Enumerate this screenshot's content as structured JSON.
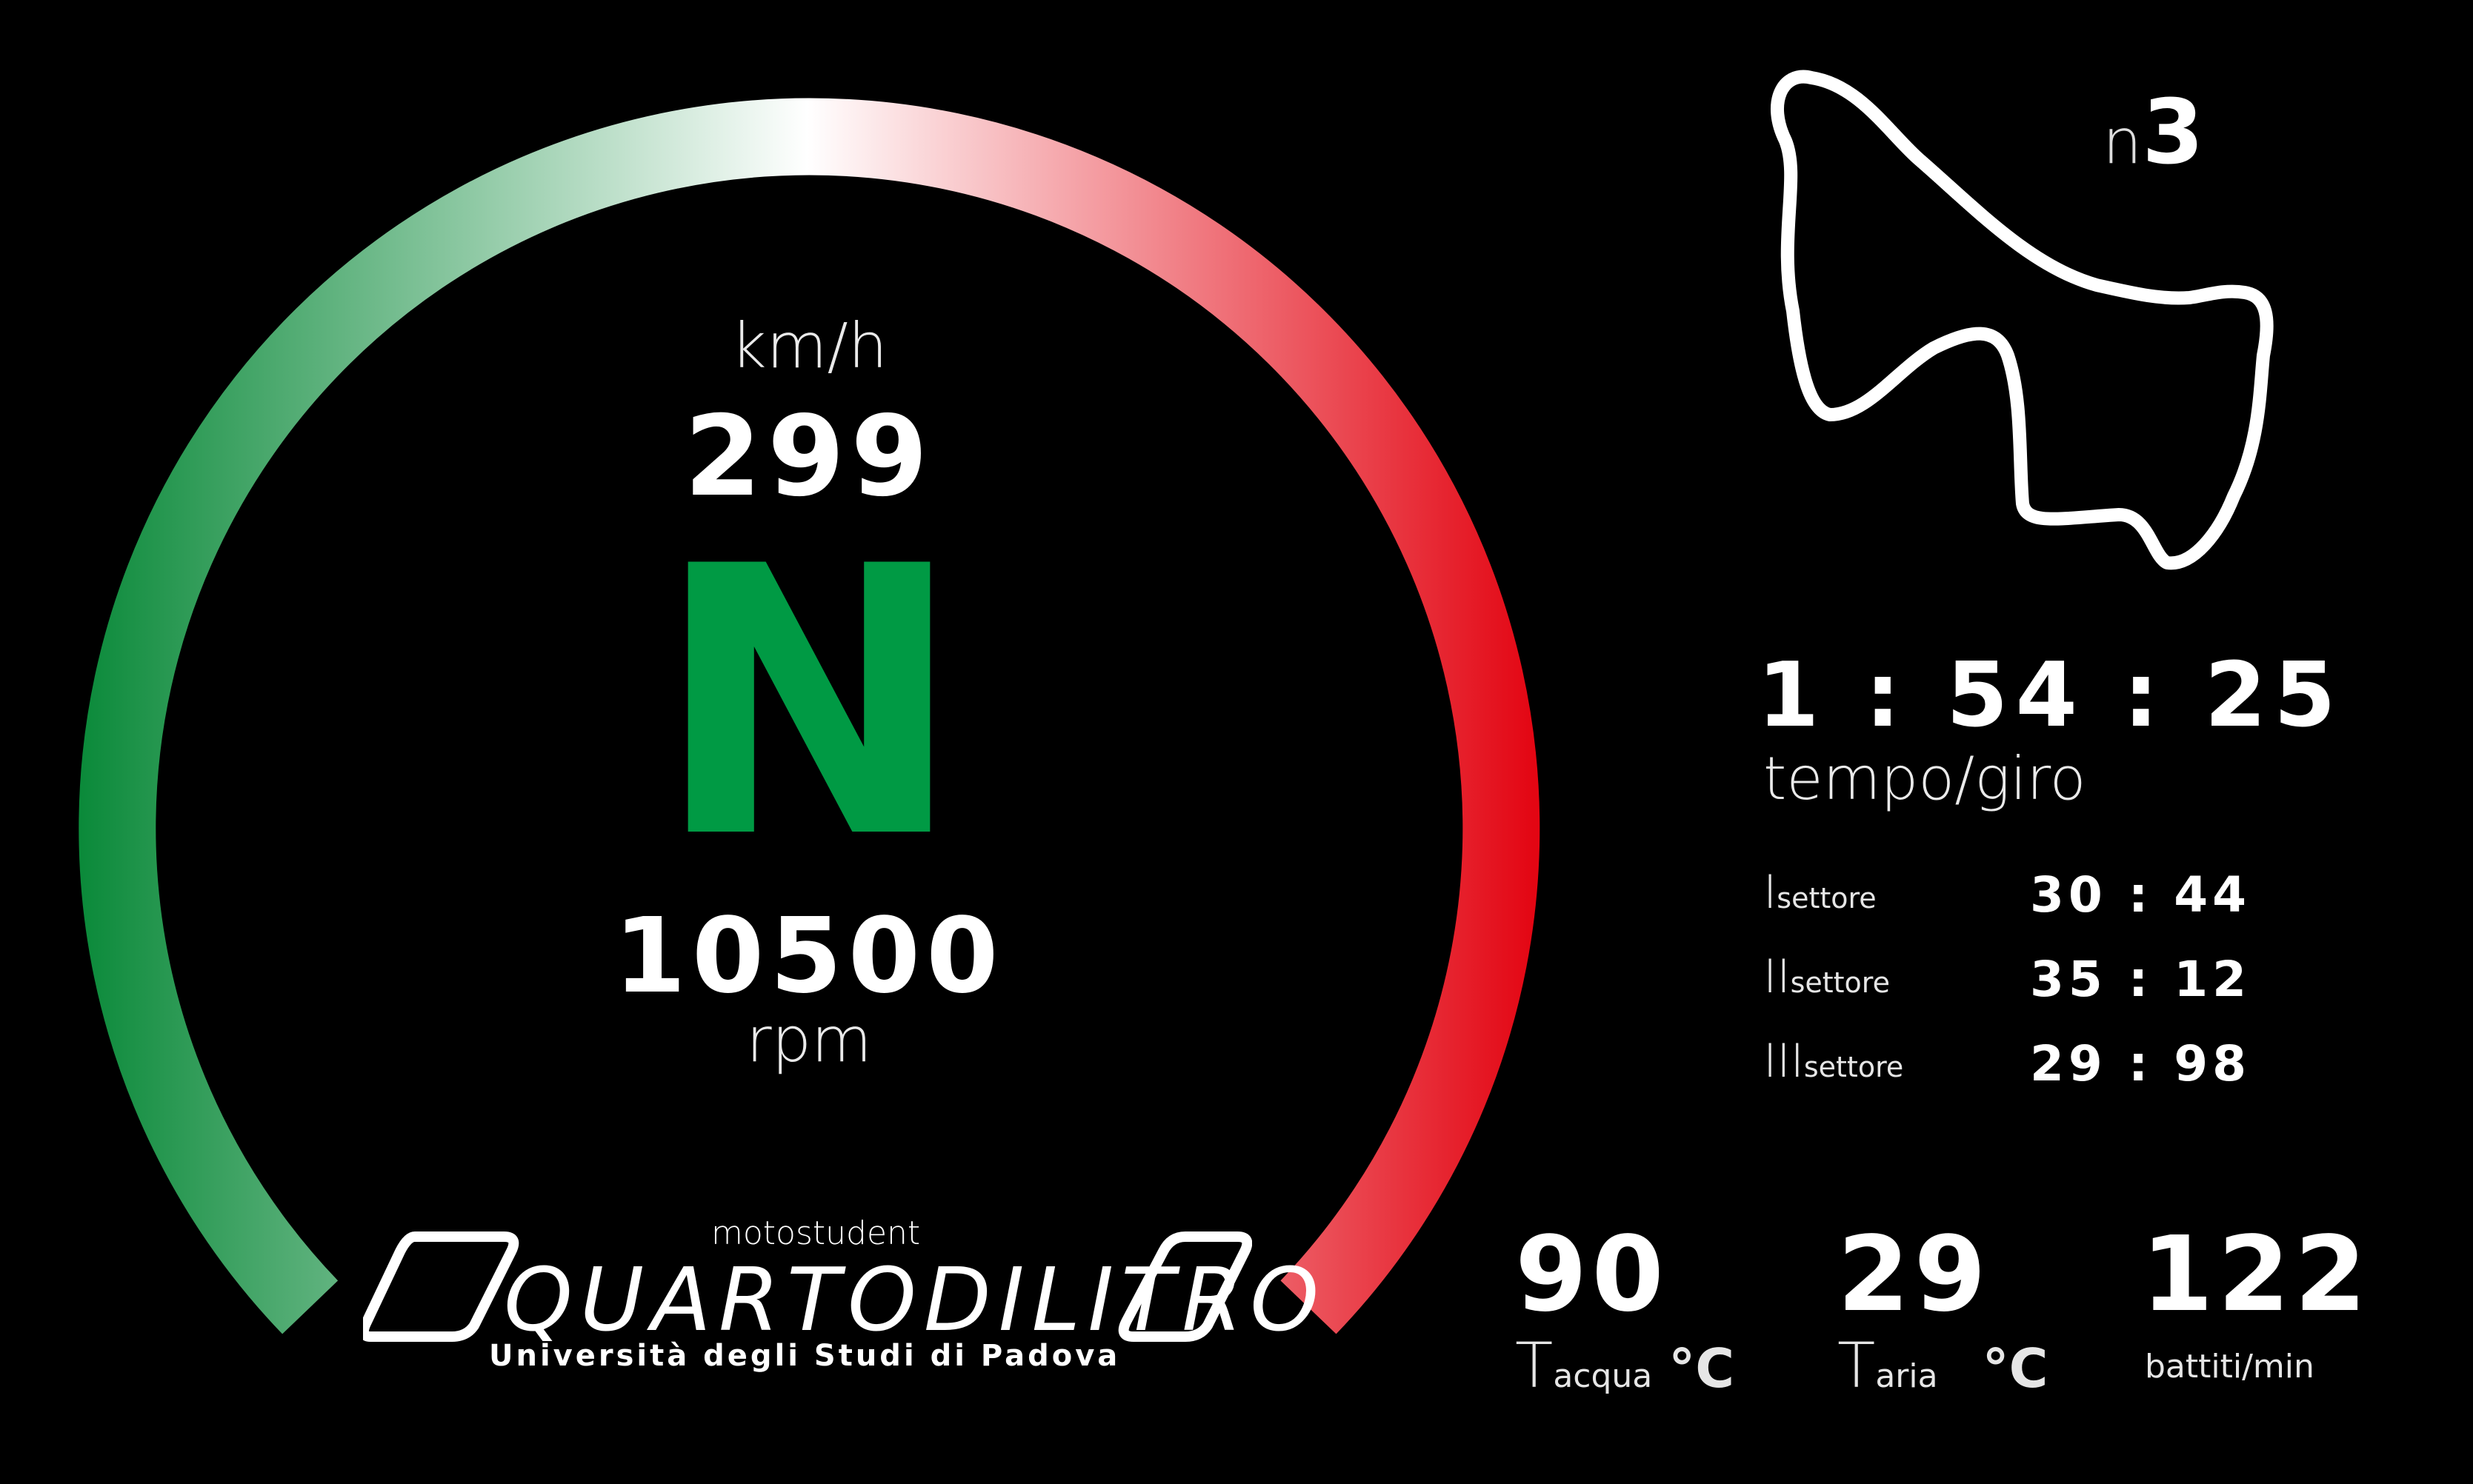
{
  "speed": {
    "unit": "km/h",
    "value": "299"
  },
  "gear": {
    "value": "N",
    "color": "#009a44"
  },
  "rpm": {
    "value": "10500",
    "unit": "rpm"
  },
  "gauge": {
    "start_color": "#0b8a3a",
    "mid_color": "#ffffff",
    "end_color": "#e30613"
  },
  "lap": {
    "prefix": "n",
    "number": "3",
    "time": "1 : 54 : 25",
    "label": "tempo/giro"
  },
  "sectors": [
    {
      "roman": "I",
      "sub": "settore",
      "value": "30 : 44"
    },
    {
      "roman": "II",
      "sub": "settore",
      "value": "35 : 12"
    },
    {
      "roman": "III",
      "sub": "settore",
      "value": "29 : 98"
    }
  ],
  "env": [
    {
      "value": "90",
      "T": "T",
      "sub": "acqua",
      "unit": "°C"
    },
    {
      "value": "29",
      "T": "T",
      "sub": "aria",
      "unit": "°C"
    },
    {
      "value": "122",
      "label": "battiti/min"
    }
  ],
  "logo": {
    "top": "motostudent",
    "main": "QUARTODILITRO",
    "bottom": "Università degli Studi di Padova"
  }
}
